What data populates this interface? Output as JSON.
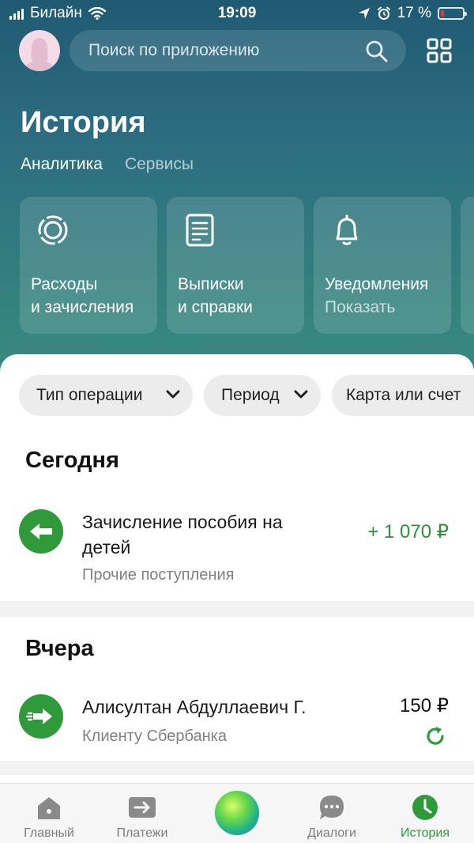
{
  "status_bar": {
    "carrier": "Билайн",
    "time": "19:09",
    "battery_text": "17 %",
    "battery_level": 0.17
  },
  "header": {
    "search_placeholder": "Поиск по приложению"
  },
  "page": {
    "title": "История",
    "tabs": [
      "Аналитика",
      "Сервисы"
    ]
  },
  "service_cards": [
    {
      "line1": "Расходы",
      "line2": "и зачисления",
      "icon": "donut-chart-icon"
    },
    {
      "line1": "Выписки",
      "line2": "и справки",
      "icon": "document-icon"
    },
    {
      "line1": "Уведомления",
      "line2": "Показать",
      "icon": "bell-icon"
    }
  ],
  "filters": [
    "Тип операции",
    "Период",
    "Карта или счет"
  ],
  "today": {
    "title": "Сегодня",
    "operations": [
      {
        "name": "Зачисление пособия на детей",
        "category": "Прочие поступления",
        "amount": "+ 1 070 ₽",
        "icon": "arrow-left-icon"
      }
    ]
  },
  "yesterday": {
    "title": "Вчера",
    "operations": [
      {
        "name": "Алисултан Абдуллаевич Г.",
        "category": "Клиенту Сбербанка",
        "amount": "150 ₽",
        "icon": "arrow-right-icon",
        "action_icon": "repeat-icon"
      }
    ]
  },
  "bottom_nav": [
    {
      "label": "Главный",
      "icon": "home-icon"
    },
    {
      "label": "Платежи",
      "icon": "transfer-icon"
    },
    {
      "label": "",
      "icon": "assistant-orb-icon"
    },
    {
      "label": "Диалоги",
      "icon": "chat-icon"
    },
    {
      "label": "История",
      "icon": "clock-icon"
    }
  ],
  "colors": {
    "accent_green": "#2f9a3a",
    "income_green": "#2f8f3a",
    "header_top": "#1f5a72",
    "header_bottom": "#3a8a80"
  }
}
